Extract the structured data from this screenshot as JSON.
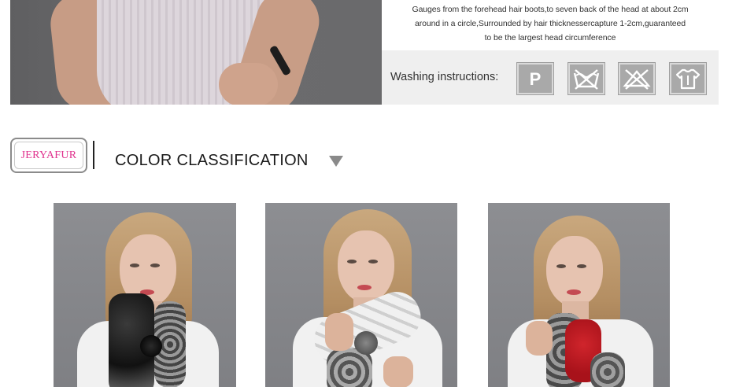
{
  "top_banner": {
    "gauge_lines": [
      "Gauges from the forehead hair boots,to seven back of the head at about 2cm",
      "around in a circle,Surrounded by hair thicknessercapture 1-2cm,guaranteed",
      "to be the largest head circumference"
    ],
    "washing_label": "Washing instructions:",
    "wash_icons": [
      {
        "name": "dry-clean-p-icon",
        "glyph": "P"
      },
      {
        "name": "do-not-wash-icon",
        "glyph": ""
      },
      {
        "name": "do-not-bleach-icon",
        "glyph": ""
      },
      {
        "name": "hang-dry-icon",
        "glyph": ""
      }
    ]
  },
  "section": {
    "brand": "JERYAFUR",
    "title": "COLOR CLASSIFICATION"
  },
  "colors": {
    "brand_pink": "#e0338e",
    "icon_gray": "#a9a9a9",
    "triangle_gray": "#8a8a8a"
  },
  "products": [
    {
      "name": "black-rex-scarf",
      "scarf_primary": "#1b1b1b",
      "scarf_secondary": "#8a8a8a"
    },
    {
      "name": "white-rex-scarf",
      "scarf_primary": "#ececec",
      "scarf_secondary": "#6f6f6f"
    },
    {
      "name": "red-rex-scarf",
      "scarf_primary": "#b3161e",
      "scarf_secondary": "#7b7b7b"
    }
  ]
}
